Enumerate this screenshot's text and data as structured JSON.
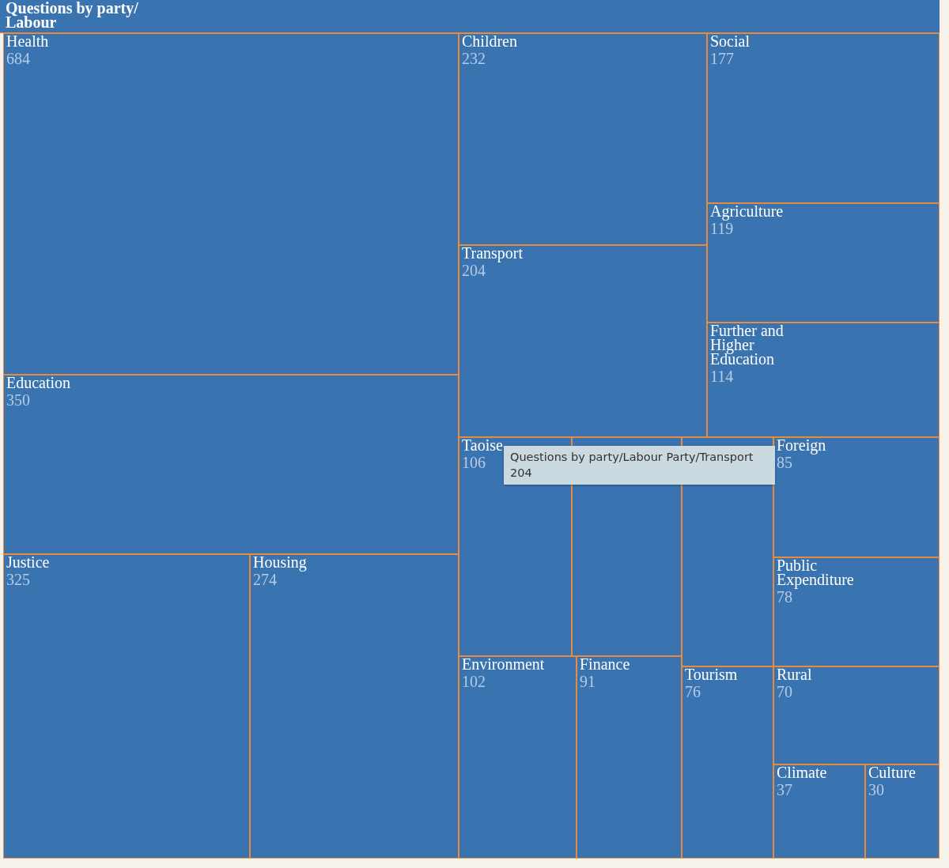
{
  "treemap": {
    "title": "Questions by party/Labour",
    "tiles": [
      {
        "kind": "tile",
        "label": "Health",
        "value": "684"
      },
      {
        "kind": "tile",
        "label": "Education",
        "value": "350"
      },
      {
        "kind": "tile",
        "label": "Justice",
        "value": "325"
      },
      {
        "kind": "tile",
        "label": "Housing",
        "value": "274"
      },
      {
        "kind": "tile",
        "label": "Children",
        "value": "232"
      },
      {
        "kind": "tile",
        "label": "Transport",
        "value": "204"
      },
      {
        "kind": "tile",
        "label": "Social",
        "value": "177"
      },
      {
        "kind": "tile",
        "label": "Agriculture",
        "value": "119"
      },
      {
        "kind": "tile",
        "label": "Further and Higher Education",
        "value": "114"
      },
      {
        "kind": "tile",
        "label": "Taoise",
        "value": "106"
      },
      {
        "kind": "tile"
      },
      {
        "kind": "tile"
      },
      {
        "kind": "tile",
        "label": "Foreign",
        "value": "85"
      },
      {
        "kind": "tile",
        "label": "Public Expenditure",
        "value": "78"
      },
      {
        "kind": "tile",
        "label": "Environment",
        "value": "102"
      },
      {
        "kind": "tile",
        "label": "Finance",
        "value": "91"
      },
      {
        "kind": "tile",
        "label": "Tourism",
        "value": "76"
      },
      {
        "kind": "tile",
        "label": "Rural",
        "value": "70"
      },
      {
        "kind": "tile",
        "label": "Climate",
        "value": "37"
      },
      {
        "kind": "tile",
        "label": "Culture",
        "value": "30"
      }
    ],
    "tooltip": {
      "path": "Questions by party/Labour Party/Transport",
      "value": "204"
    }
  }
}
